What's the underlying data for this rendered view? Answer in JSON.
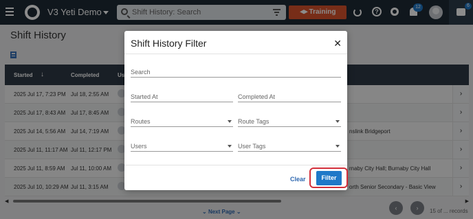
{
  "app": {
    "title": "V3 Yeti Demo",
    "search_placeholder": "Shift History: Search",
    "training_label": "Training",
    "notifications_count": "12",
    "chat_count": "6"
  },
  "page": {
    "title": "Shift History"
  },
  "table": {
    "headers": {
      "started": "Started",
      "completed": "Completed",
      "user": "Us"
    },
    "rows": [
      {
        "started": "2025 Jul 17, 7:23 PM",
        "completed": "Jul 18, 2:55 AM",
        "extra": ""
      },
      {
        "started": "2025 Jul 17, 8:43 AM",
        "completed": "Jul 17, 8:45 AM",
        "extra": ""
      },
      {
        "started": "2025 Jul 14, 5:56 AM",
        "completed": "Jul 14, 7:19 AM",
        "extra": "nslink Bridgeport"
      },
      {
        "started": "2025 Jul 11, 11:17 AM",
        "completed": "Jul 11, 12:17 PM",
        "extra": ""
      },
      {
        "started": "2025 Jul 11, 8:59 AM",
        "completed": "Jul 11, 10:00 AM",
        "extra": "rnaby City Hall; Burnaby City Hall"
      },
      {
        "started": "2025 Jul 10, 10:29 AM",
        "completed": "Jul 11, 3:15 AM",
        "extra": "orth Senior Secondary - Basic View"
      }
    ]
  },
  "pagination": {
    "next_label": "Next Page",
    "records_label": "15 of ... records"
  },
  "modal": {
    "title": "Shift History Filter",
    "search_label": "Search",
    "started_label": "Started At",
    "completed_label": "Completed At",
    "routes_label": "Routes",
    "route_tags_label": "Route Tags",
    "users_label": "Users",
    "user_tags_label": "User Tags",
    "clear_label": "Clear",
    "filter_label": "Filter"
  },
  "colors": {
    "accent": "#1f78c8",
    "training": "#d9522c",
    "highlight": "#d42e3a",
    "nav": "#1e2a36"
  }
}
